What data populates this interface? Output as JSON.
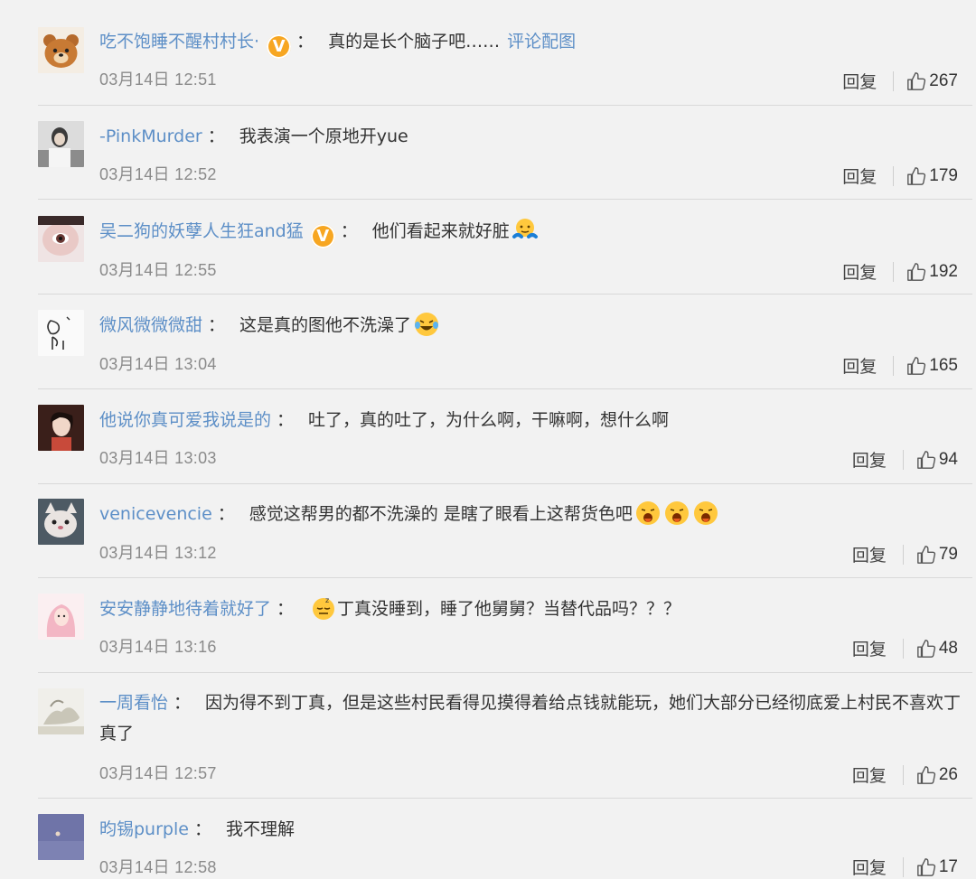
{
  "comments": [
    {
      "user": "吃不饱睡不醒村村长·",
      "verified": true,
      "content": "真的是长个脑子吧……",
      "link": "评论配图",
      "time": "03月14日 12:51",
      "reply": "回复",
      "likes": "267"
    },
    {
      "user": "-PinkMurder",
      "verified": false,
      "content": "我表演一个原地开yue",
      "time": "03月14日 12:52",
      "reply": "回复",
      "likes": "179"
    },
    {
      "user": "吴二狗的妖孽人生狂and猛",
      "verified": true,
      "content": "他们看起来就好脏",
      "time": "03月14日 12:55",
      "reply": "回复",
      "likes": "192"
    },
    {
      "user": "微风微微微甜",
      "verified": false,
      "content": "这是真的图他不洗澡了",
      "time": "03月14日 13:04",
      "reply": "回复",
      "likes": "165"
    },
    {
      "user": "他说你真可爱我说是的",
      "verified": false,
      "content": "吐了，真的吐了，为什么啊，干嘛啊，想什么啊",
      "time": "03月14日 13:03",
      "reply": "回复",
      "likes": "94"
    },
    {
      "user": "venicevencie",
      "verified": false,
      "content": "感觉这帮男的都不洗澡的 是瞎了眼看上这帮货色吧",
      "time": "03月14日 13:12",
      "reply": "回复",
      "likes": "79"
    },
    {
      "user": "安安静静地待着就好了",
      "verified": false,
      "content": "丁真没睡到，睡了他舅舅？当替代品吗？？？",
      "time": "03月14日 13:16",
      "reply": "回复",
      "likes": "48"
    },
    {
      "user": "一周看怡",
      "verified": false,
      "content": "因为得不到丁真，但是这些村民看得见摸得着给点钱就能玩，她们大部分已经彻底爱上村民不喜欢丁真了",
      "time": "03月14日 12:57",
      "reply": "回复",
      "likes": "26"
    },
    {
      "user": "昀锡purple",
      "verified": false,
      "content": "我不理解",
      "time": "03月14日 12:58",
      "reply": "回复",
      "likes": "17"
    }
  ],
  "colors": {
    "username": "#5d8fc7",
    "background": "#f2f2f2",
    "verified_badge": "#f7a621"
  }
}
